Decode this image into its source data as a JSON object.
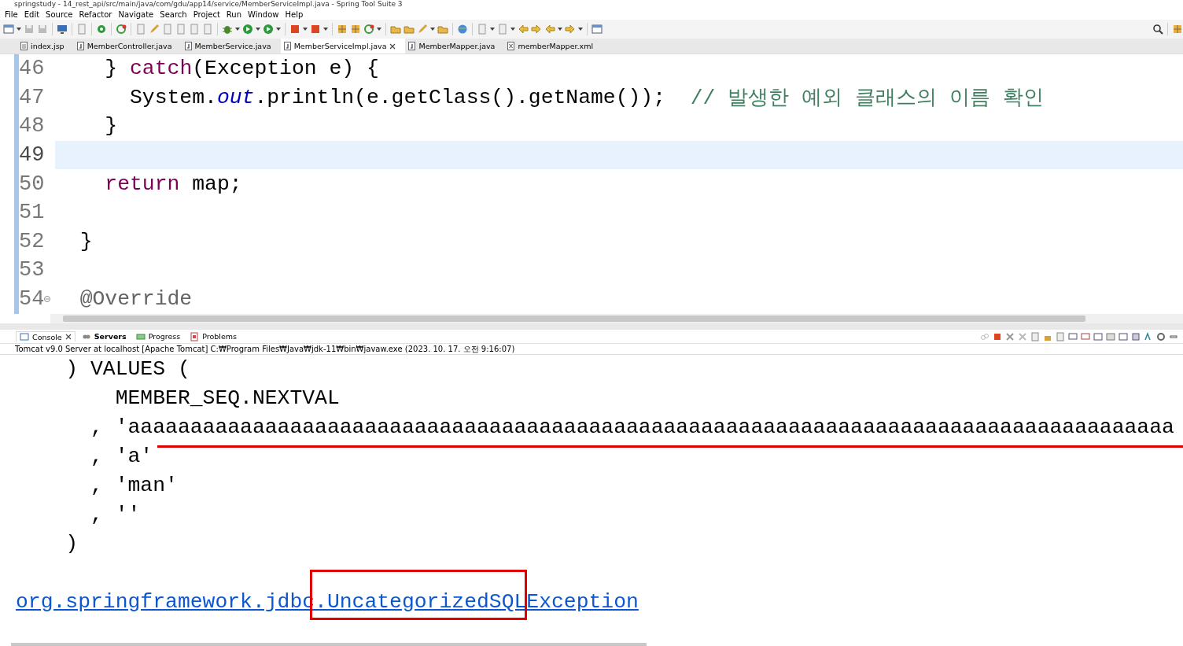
{
  "window": {
    "title": "springstudy - 14_rest_api/src/main/java/com/gdu/app14/service/MemberServiceImpl.java - Spring Tool Suite 3"
  },
  "menu": [
    "File",
    "Edit",
    "Source",
    "Refactor",
    "Navigate",
    "Search",
    "Project",
    "Run",
    "Window",
    "Help"
  ],
  "editor_tabs": [
    {
      "label": "index.jsp",
      "kind": "jsp",
      "selected": false
    },
    {
      "label": "MemberController.java",
      "kind": "java",
      "selected": false
    },
    {
      "label": "MemberService.java",
      "kind": "java",
      "selected": false
    },
    {
      "label": "MemberServiceImpl.java",
      "kind": "java",
      "selected": true
    },
    {
      "label": "MemberMapper.java",
      "kind": "java",
      "selected": false
    },
    {
      "label": "memberMapper.xml",
      "kind": "xml",
      "selected": false
    }
  ],
  "editor": {
    "lines": [
      {
        "number": "46",
        "current": false,
        "foldable": false,
        "tokens": [
          {
            "kind": "plain",
            "text": "    } "
          },
          {
            "kind": "keyword",
            "text": "catch"
          },
          {
            "kind": "plain",
            "text": "(Exception e) {"
          }
        ]
      },
      {
        "number": "47",
        "current": false,
        "foldable": false,
        "tokens": [
          {
            "kind": "plain",
            "text": "      System."
          },
          {
            "kind": "field",
            "text": "out"
          },
          {
            "kind": "plain",
            "text": ".println(e.getClass().getName());  "
          },
          {
            "kind": "comment",
            "text": "// 발생한 예외 클래스의 이름 확인"
          }
        ]
      },
      {
        "number": "48",
        "current": false,
        "foldable": false,
        "tokens": [
          {
            "kind": "plain",
            "text": "    }"
          }
        ]
      },
      {
        "number": "49",
        "current": true,
        "foldable": false
      },
      {
        "number": "50",
        "current": false,
        "foldable": false,
        "tokens": [
          {
            "kind": "keyword",
            "text": "    return"
          },
          {
            "kind": "plain",
            "text": " map;"
          }
        ]
      },
      {
        "number": "51",
        "current": false,
        "foldable": false
      },
      {
        "number": "52",
        "current": false,
        "foldable": false,
        "tokens": [
          {
            "kind": "plain",
            "text": "  }"
          }
        ]
      },
      {
        "number": "53",
        "current": false,
        "foldable": false
      },
      {
        "number": "54",
        "current": false,
        "foldable": true,
        "tokens": [
          {
            "kind": "annotation",
            "text": "  @Override"
          }
        ]
      }
    ]
  },
  "console": {
    "tabs": [
      {
        "label": "Console",
        "selected": true,
        "bold": false
      },
      {
        "label": "Servers",
        "selected": false,
        "bold": true
      },
      {
        "label": "Progress",
        "selected": false,
        "bold": false
      },
      {
        "label": "Problems",
        "selected": false,
        "bold": false
      }
    ],
    "header": "Tomcat v9.0 Server at localhost [Apache Tomcat] C:₩Program Files₩Java₩jdk-11₩bin₩javaw.exe  (2023. 10. 17. 오전 9:16:07)",
    "lines": [
      "    ) VALUES (",
      "        MEMBER_SEQ.NEXTVAL",
      "      , 'aaaaaaaaaaaaaaaaaaaaaaaaaaaaaaaaaaaaaaaaaaaaaaaaaaaaaaaaaaaaaaaaaaaaaaaaaaaaaaaaaaaa",
      "      , 'a'",
      "      , 'man'",
      "      , ''",
      "    )"
    ],
    "exception": "org.springframework.jdbc.UncategorizedSQLException"
  }
}
